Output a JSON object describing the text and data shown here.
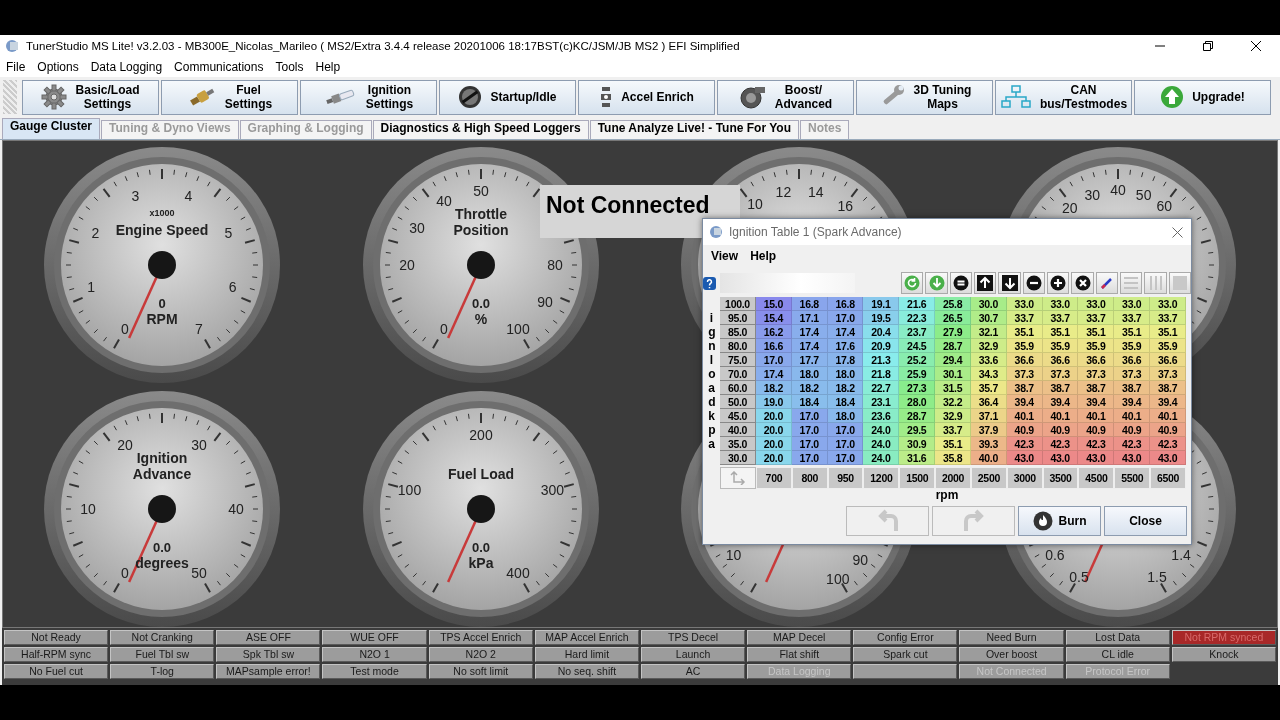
{
  "window": {
    "title": "TunerStudio MS Lite! v3.2.03 - MB300E_Nicolas_Marileo ( MS2/Extra 3.4.4 release  20201006 18:17BST(c)KC/JSM/JB   MS2 ) EFI Simplified"
  },
  "menu": [
    "File",
    "Options",
    "Data Logging",
    "Communications",
    "Tools",
    "Help"
  ],
  "toolbar": [
    {
      "lines": [
        "Basic/Load",
        "Settings"
      ]
    },
    {
      "lines": [
        "Fuel",
        "Settings"
      ]
    },
    {
      "lines": [
        "Ignition",
        "Settings"
      ]
    },
    {
      "lines": [
        "Startup/Idle"
      ]
    },
    {
      "lines": [
        "Accel Enrich"
      ]
    },
    {
      "lines": [
        "Boost/",
        "Advanced"
      ]
    },
    {
      "lines": [
        "3D Tuning",
        "Maps"
      ]
    },
    {
      "lines": [
        "CAN",
        "bus/Testmodes"
      ]
    },
    {
      "lines": [
        "Upgrade!"
      ]
    }
  ],
  "tabs": [
    {
      "label": "Gauge Cluster",
      "selected": true,
      "disabled": false
    },
    {
      "label": "Tuning & Dyno Views",
      "selected": false,
      "disabled": true
    },
    {
      "label": "Graphing & Logging",
      "selected": false,
      "disabled": true
    },
    {
      "label": "Diagnostics & High Speed Loggers",
      "selected": false,
      "disabled": false
    },
    {
      "label": "Tune Analyze Live! - Tune For You",
      "selected": false,
      "disabled": false
    },
    {
      "label": "Notes",
      "selected": false,
      "disabled": true
    }
  ],
  "gauges": [
    {
      "header": "x1000",
      "title_lines": [
        "Engine Speed"
      ],
      "value": "0",
      "unit": "RPM",
      "ticks": [
        "0",
        "1",
        "2",
        "3",
        "4",
        "5",
        "6",
        "7"
      ]
    },
    {
      "title_lines": [
        "Throttle",
        "Position"
      ],
      "value": "0.0",
      "unit": "%",
      "ticks": [
        "0",
        "20",
        "30",
        "40",
        "50",
        "80",
        "90",
        "100"
      ]
    },
    {
      "ticks": [
        "10",
        "12",
        "14",
        "16"
      ]
    },
    {
      "ticks": [
        "20",
        "30",
        "40",
        "50",
        "60"
      ]
    },
    {
      "title_lines": [
        "Ignition",
        "Advance"
      ],
      "value": "0.0",
      "unit": "degrees",
      "ticks": [
        "0",
        "10",
        "20",
        "30",
        "40",
        "50"
      ]
    },
    {
      "title_lines": [
        "Fuel Load"
      ],
      "value": "0.0",
      "unit": "kPa",
      "ticks": [
        "100",
        "200",
        "300",
        "400"
      ]
    },
    {
      "ticks": [
        "10",
        "90",
        "100"
      ]
    },
    {
      "ticks": [
        "0.5",
        "0.6",
        "1.4",
        "1.5"
      ]
    }
  ],
  "connection_banner": "Not Connected",
  "status_flags": [
    {
      "kind": "flag",
      "label": "Not Ready",
      "active": false,
      "disabled": false
    },
    {
      "kind": "flag",
      "label": "Not Cranking",
      "active": false,
      "disabled": false
    },
    {
      "kind": "flag",
      "label": "ASE OFF",
      "active": false,
      "disabled": false
    },
    {
      "kind": "flag",
      "label": "WUE OFF",
      "active": false,
      "disabled": false
    },
    {
      "kind": "flag",
      "label": "TPS Accel Enrich",
      "active": false,
      "disabled": false
    },
    {
      "kind": "flag",
      "label": "MAP Accel Enrich",
      "active": false,
      "disabled": false
    },
    {
      "kind": "flag",
      "label": "TPS Decel",
      "active": false,
      "disabled": false
    },
    {
      "kind": "flag",
      "label": "MAP Decel",
      "active": false,
      "disabled": false
    },
    {
      "kind": "flag",
      "label": "Config Error",
      "active": false,
      "disabled": false
    },
    {
      "kind": "flag",
      "label": "Need Burn",
      "active": false,
      "disabled": false
    },
    {
      "kind": "flag",
      "label": "Lost Data",
      "active": false,
      "disabled": false
    },
    {
      "kind": "flag",
      "label": "Not RPM synced",
      "active": true,
      "disabled": false
    },
    {
      "kind": "flag",
      "label": "Half-RPM sync",
      "active": false,
      "disabled": false
    },
    {
      "kind": "flag",
      "label": "Fuel Tbl sw",
      "active": false,
      "disabled": false
    },
    {
      "kind": "flag",
      "label": "Spk Tbl sw",
      "active": false,
      "disabled": false
    },
    {
      "kind": "flag",
      "label": "N2O 1",
      "active": false,
      "disabled": false
    },
    {
      "kind": "flag",
      "label": "N2O 2",
      "active": false,
      "disabled": false
    },
    {
      "kind": "flag",
      "label": "Hard limit",
      "active": false,
      "disabled": false
    },
    {
      "kind": "flag",
      "label": "Launch",
      "active": false,
      "disabled": false
    },
    {
      "kind": "flag",
      "label": "Flat shift",
      "active": false,
      "disabled": false
    },
    {
      "kind": "flag",
      "label": "Spark cut",
      "active": false,
      "disabled": false
    },
    {
      "kind": "flag",
      "label": "Over boost",
      "active": false,
      "disabled": false
    },
    {
      "kind": "flag",
      "label": "CL idle",
      "active": false,
      "disabled": false
    },
    {
      "kind": "flag",
      "label": "Knock",
      "active": false,
      "disabled": false
    },
    {
      "kind": "flag",
      "label": "No Fuel cut",
      "active": false,
      "disabled": false
    },
    {
      "kind": "flag",
      "label": "T-log",
      "active": false,
      "disabled": false
    },
    {
      "kind": "flag",
      "label": "MAPsample error!",
      "active": false,
      "disabled": false
    },
    {
      "kind": "flag",
      "label": "Test mode",
      "active": false,
      "disabled": false
    },
    {
      "kind": "flag",
      "label": "No soft limit",
      "active": false,
      "disabled": false
    },
    {
      "kind": "flag",
      "label": "No seq. shift",
      "active": false,
      "disabled": false
    },
    {
      "kind": "flag",
      "label": "AC",
      "active": false,
      "disabled": false
    },
    {
      "kind": "flag",
      "label": "Data Logging",
      "active": false,
      "disabled": true
    },
    {
      "kind": "empty"
    },
    {
      "kind": "flag",
      "label": "Not Connected",
      "active": false,
      "disabled": true
    },
    {
      "kind": "flag",
      "label": "Protocol Error",
      "active": false,
      "disabled": true
    }
  ],
  "dialog": {
    "title": "Ignition Table 1 (Spark Advance)",
    "menu": [
      "View",
      "Help"
    ],
    "toolbar": [
      {
        "disabled": false
      },
      {
        "disabled": false
      },
      {
        "disabled": false
      },
      {
        "disabled": false
      },
      {
        "disabled": false
      },
      {
        "disabled": false
      },
      {
        "disabled": false
      },
      {
        "disabled": false
      },
      {
        "disabled": false
      },
      {
        "disabled": true
      },
      {
        "disabled": true
      },
      {
        "disabled": true
      }
    ],
    "y_axis_label": "ignload kpa",
    "x_axis_label": "rpm",
    "rpm": [
      "700",
      "800",
      "950",
      "1200",
      "1500",
      "2000",
      "2500",
      "3000",
      "3500",
      "4500",
      "5500",
      "6500"
    ],
    "rows": [
      {
        "load": "100.0",
        "values": [
          "15.0",
          "16.8",
          "16.8",
          "19.1",
          "21.6",
          "25.8",
          "30.0",
          "33.0",
          "33.0",
          "33.0",
          "33.0",
          "33.0"
        ]
      },
      {
        "load": "95.0",
        "values": [
          "15.4",
          "17.1",
          "17.0",
          "19.5",
          "22.3",
          "26.5",
          "30.7",
          "33.7",
          "33.7",
          "33.7",
          "33.7",
          "33.7"
        ]
      },
      {
        "load": "85.0",
        "values": [
          "16.2",
          "17.4",
          "17.4",
          "20.4",
          "23.7",
          "27.9",
          "32.1",
          "35.1",
          "35.1",
          "35.1",
          "35.1",
          "35.1"
        ]
      },
      {
        "load": "80.0",
        "values": [
          "16.6",
          "17.4",
          "17.6",
          "20.9",
          "24.5",
          "28.7",
          "32.9",
          "35.9",
          "35.9",
          "35.9",
          "35.9",
          "35.9"
        ]
      },
      {
        "load": "75.0",
        "values": [
          "17.0",
          "17.7",
          "17.8",
          "21.3",
          "25.2",
          "29.4",
          "33.6",
          "36.6",
          "36.6",
          "36.6",
          "36.6",
          "36.6"
        ]
      },
      {
        "load": "70.0",
        "values": [
          "17.4",
          "18.0",
          "18.0",
          "21.8",
          "25.9",
          "30.1",
          "34.3",
          "37.3",
          "37.3",
          "37.3",
          "37.3",
          "37.3"
        ]
      },
      {
        "load": "60.0",
        "values": [
          "18.2",
          "18.2",
          "18.2",
          "22.7",
          "27.3",
          "31.5",
          "35.7",
          "38.7",
          "38.7",
          "38.7",
          "38.7",
          "38.7"
        ]
      },
      {
        "load": "50.0",
        "values": [
          "19.0",
          "18.4",
          "18.4",
          "23.1",
          "28.0",
          "32.2",
          "36.4",
          "39.4",
          "39.4",
          "39.4",
          "39.4",
          "39.4"
        ]
      },
      {
        "load": "45.0",
        "values": [
          "20.0",
          "17.0",
          "18.0",
          "23.6",
          "28.7",
          "32.9",
          "37.1",
          "40.1",
          "40.1",
          "40.1",
          "40.1",
          "40.1"
        ]
      },
      {
        "load": "40.0",
        "values": [
          "20.0",
          "17.0",
          "17.0",
          "24.0",
          "29.5",
          "33.7",
          "37.9",
          "40.9",
          "40.9",
          "40.9",
          "40.9",
          "40.9"
        ]
      },
      {
        "load": "35.0",
        "values": [
          "20.0",
          "17.0",
          "17.0",
          "24.0",
          "30.9",
          "35.1",
          "39.3",
          "42.3",
          "42.3",
          "42.3",
          "42.3",
          "42.3"
        ]
      },
      {
        "load": "30.0",
        "values": [
          "20.0",
          "17.0",
          "17.0",
          "24.0",
          "31.6",
          "35.8",
          "40.0",
          "43.0",
          "43.0",
          "43.0",
          "43.0",
          "43.0"
        ]
      }
    ],
    "buttons": [
      {
        "kind": "undo",
        "disabled": true
      },
      {
        "kind": "redo",
        "disabled": true
      },
      {
        "kind": "burn",
        "label": "Burn",
        "disabled": false
      },
      {
        "kind": "close",
        "label": "Close",
        "disabled": false
      }
    ]
  }
}
